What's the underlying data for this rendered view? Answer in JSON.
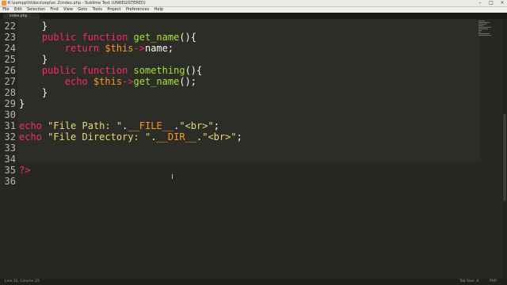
{
  "window": {
    "title": "K:\\xampp\\htdocs\\oop\\ec 2\\index.php - Sublime Text (UNREGISTERED)",
    "controls": [
      "–",
      "□",
      "×"
    ]
  },
  "menu": [
    "File",
    "Edit",
    "Selection",
    "Find",
    "View",
    "Goto",
    "Tools",
    "Project",
    "Preferences",
    "Help"
  ],
  "tab": {
    "label": "index.php"
  },
  "editor": {
    "lines": [
      {
        "num": "22",
        "code": "    }"
      },
      {
        "num": "23",
        "code": "    public function get_name(){"
      },
      {
        "num": "24",
        "code": "        return $this->name;"
      },
      {
        "num": "25",
        "code": "    }"
      },
      {
        "num": "26",
        "code": "    public function something(){"
      },
      {
        "num": "27",
        "code": "        echo $this->get_name();"
      },
      {
        "num": "28",
        "code": "    }"
      },
      {
        "num": "29",
        "code": "}"
      },
      {
        "num": "30",
        "code": ""
      },
      {
        "num": "31",
        "code": "echo \"File Path: \".__FILE__.\"<br>\";"
      },
      {
        "num": "32",
        "code": "echo \"File Directory: \".__DIR__.\"<br>\";"
      },
      {
        "num": "33",
        "code": ""
      },
      {
        "num": "34",
        "code": ""
      },
      {
        "num": "35",
        "code": "?>"
      },
      {
        "num": "36",
        "code": ""
      }
    ]
  },
  "status": {
    "position": "Line 32, Column 25",
    "tab_size": "Tab Size: 4",
    "syntax": "PHP"
  },
  "colors": {
    "background": "#272822",
    "keyword": "#f92672",
    "function": "#a6e22e",
    "string": "#e6db74",
    "variable": "#fd971f"
  }
}
